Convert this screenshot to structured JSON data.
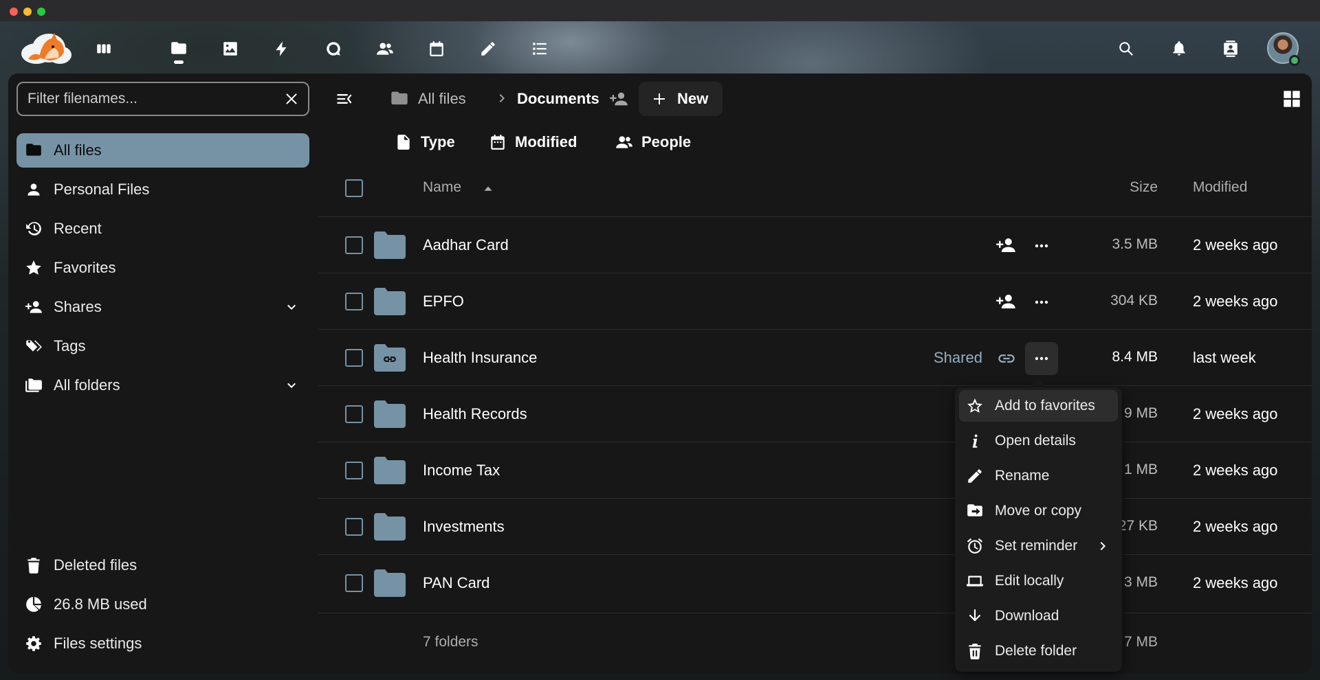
{
  "window": {
    "colors": {
      "accent": "#7693a5",
      "folder": "#7693a5",
      "shared_text": "#93afc1"
    }
  },
  "topnav": {
    "apps": [
      {
        "name": "dashboard-icon"
      },
      {
        "name": "files-icon",
        "active": true
      },
      {
        "name": "photos-icon"
      },
      {
        "name": "activity-icon"
      },
      {
        "name": "talk-icon"
      },
      {
        "name": "contacts-icon"
      },
      {
        "name": "calendar-icon"
      },
      {
        "name": "notes-icon"
      },
      {
        "name": "tasks-icon"
      }
    ],
    "right": [
      "search-icon",
      "notifications-icon",
      "contacts-menu-icon",
      "avatar"
    ]
  },
  "sidebar": {
    "filter_placeholder": "Filter filenames...",
    "items": [
      {
        "label": "All files",
        "icon": "folder-icon",
        "active": true
      },
      {
        "label": "Personal Files",
        "icon": "person-icon"
      },
      {
        "label": "Recent",
        "icon": "history-icon"
      },
      {
        "label": "Favorites",
        "icon": "star-icon"
      },
      {
        "label": "Shares",
        "icon": "share-icon",
        "expandable": true
      },
      {
        "label": "Tags",
        "icon": "tag-icon"
      },
      {
        "label": "All folders",
        "icon": "folders-icon",
        "expandable": true
      }
    ],
    "bottom": {
      "deleted": "Deleted files",
      "quota": "26.8 MB used",
      "settings": "Files settings"
    }
  },
  "toolbar": {
    "breadcrumb_root": "All files",
    "breadcrumb_current": "Documents",
    "new_label": "New"
  },
  "filters": {
    "type": "Type",
    "modified": "Modified",
    "people": "People"
  },
  "table": {
    "headers": {
      "name": "Name",
      "size": "Size",
      "modified": "Modified"
    },
    "rows": [
      {
        "name": "Aadhar Card",
        "size": "3.5 MB",
        "modified": "2 weeks ago"
      },
      {
        "name": "EPFO",
        "size": "304 KB",
        "modified": "2 weeks ago"
      },
      {
        "name": "Health Insurance",
        "size": "8.4 MB",
        "modified": "last week",
        "shared_label": "Shared"
      },
      {
        "name": "Health Records",
        "size": "9 MB",
        "modified": "2 weeks ago"
      },
      {
        "name": "Income Tax",
        "size": "1 MB",
        "modified": "2 weeks ago"
      },
      {
        "name": "Investments",
        "size": "27 KB",
        "modified": "2 weeks ago"
      },
      {
        "name": "PAN Card",
        "size": "3 MB",
        "modified": "2 weeks ago"
      }
    ],
    "footer": {
      "count": "7 folders",
      "total": "7 MB"
    }
  },
  "menu": {
    "items": [
      {
        "label": "Add to favorites",
        "icon": "star-outline-icon"
      },
      {
        "label": "Open details",
        "icon": "info-icon"
      },
      {
        "label": "Rename",
        "icon": "pencil-icon"
      },
      {
        "label": "Move or copy",
        "icon": "folder-move-icon"
      },
      {
        "label": "Set reminder",
        "icon": "alarm-icon"
      },
      {
        "label": "Edit locally",
        "icon": "laptop-icon"
      },
      {
        "label": "Download",
        "icon": "download-icon"
      },
      {
        "label": "Delete folder",
        "icon": "trash-icon"
      }
    ]
  }
}
